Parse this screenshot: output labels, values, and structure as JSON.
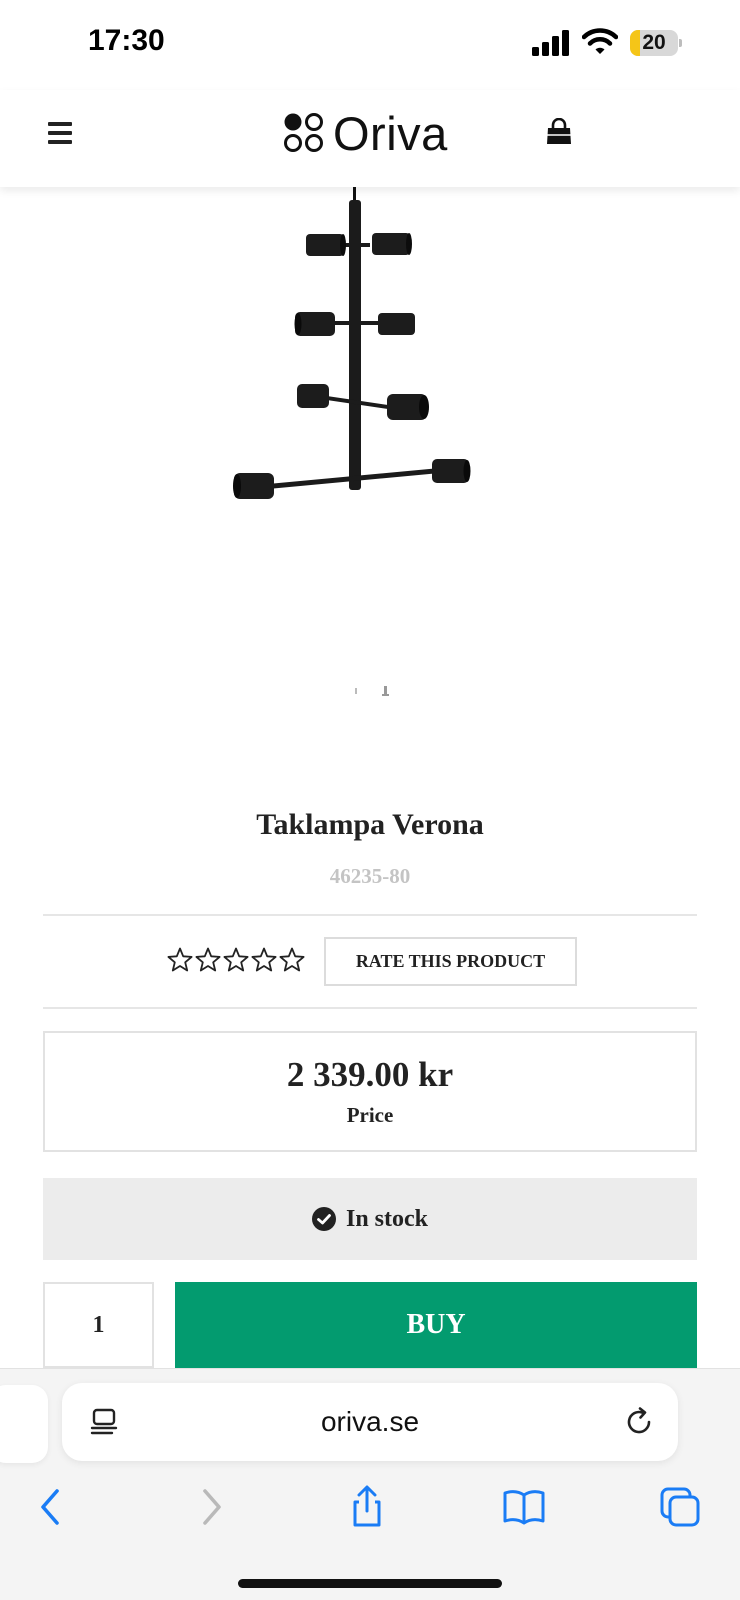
{
  "status_bar": {
    "time": "17:30",
    "battery_level": "20",
    "battery_fraction": 0.2,
    "battery_color": "#f5c518"
  },
  "header": {
    "logo_text": "Oriva",
    "menu_icon": "hamburger-icon",
    "cart_icon": "shopping-bag-icon"
  },
  "product": {
    "title": "Taklampa Verona",
    "sku": "46235-80",
    "rating_stars": 5,
    "rating_value": 0,
    "rate_button_label": "RATE THIS PRODUCT",
    "price": "2 339.00 kr",
    "price_label": "Price",
    "stock_status": "In stock",
    "quantity": "1",
    "buy_label": "BUY"
  },
  "colors": {
    "buy_button": "#039b6f",
    "stock_background": "#ececec",
    "sku_text": "#c4c4c4"
  },
  "browser": {
    "url": "oriva.se",
    "toolbar": [
      "back-icon",
      "forward-icon",
      "share-icon",
      "bookmarks-icon",
      "tabs-icon"
    ]
  }
}
